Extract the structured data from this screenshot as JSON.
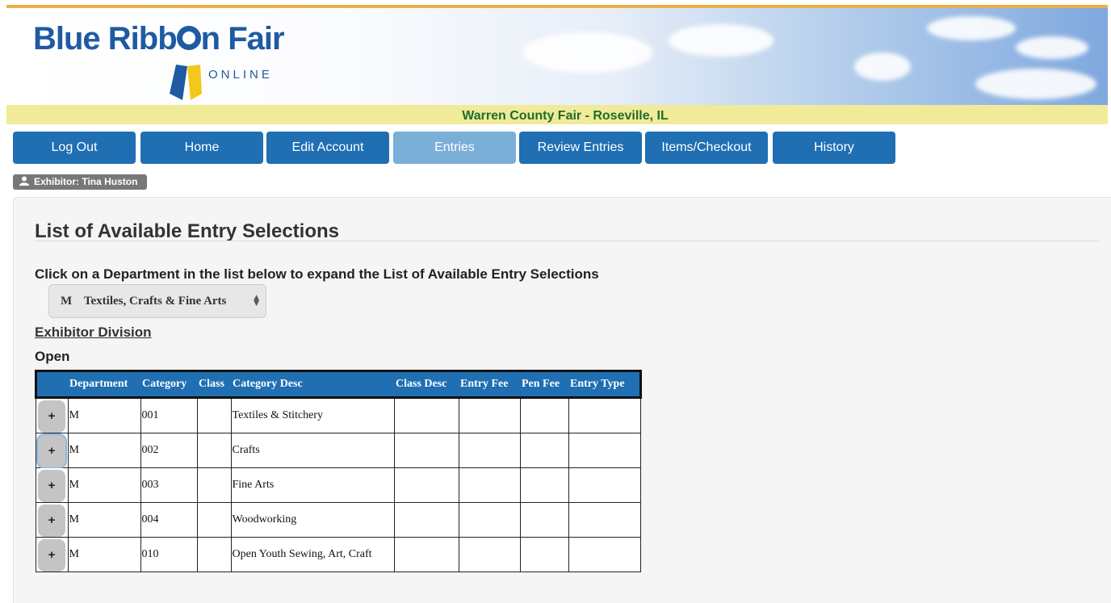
{
  "brand": {
    "logo_text_1": "Blue Ribb",
    "logo_text_2": "n Fair",
    "logo_sub": "ONLINE"
  },
  "fair_name": "Warren County Fair - Roseville, IL",
  "nav": [
    {
      "label": "Log Out",
      "active": false
    },
    {
      "label": "Home",
      "active": false
    },
    {
      "label": "Edit Account",
      "active": false
    },
    {
      "label": "Entries",
      "active": true
    },
    {
      "label": "Review Entries",
      "active": false
    },
    {
      "label": "Items/Checkout",
      "active": false
    },
    {
      "label": "History",
      "active": false
    }
  ],
  "exhibitor_label": "Exhibitor: Tina Huston",
  "page_title": "List of Available Entry Selections",
  "instruction": "Click on a Department in the list below to expand the List of Available Entry Selections",
  "department_select": {
    "selected": "M    Textiles, Crafts & Fine Arts"
  },
  "division_heading": "Exhibitor Division",
  "division_value": "Open",
  "table": {
    "headers": [
      "",
      "Department",
      "Category",
      "Class",
      "Category Desc",
      "Class Desc",
      "Entry Fee",
      "Pen Fee",
      "Entry Type"
    ],
    "expand_label": "+",
    "rows": [
      {
        "department": "M",
        "category": "001",
        "class": "",
        "category_desc": "Textiles & Stitchery",
        "class_desc": "",
        "entry_fee": "",
        "pen_fee": "",
        "entry_type": ""
      },
      {
        "department": "M",
        "category": "002",
        "class": "",
        "category_desc": "Crafts",
        "class_desc": "",
        "entry_fee": "",
        "pen_fee": "",
        "entry_type": ""
      },
      {
        "department": "M",
        "category": "003",
        "class": "",
        "category_desc": "Fine Arts",
        "class_desc": "",
        "entry_fee": "",
        "pen_fee": "",
        "entry_type": ""
      },
      {
        "department": "M",
        "category": "004",
        "class": "",
        "category_desc": "Woodworking",
        "class_desc": "",
        "entry_fee": "",
        "pen_fee": "",
        "entry_type": ""
      },
      {
        "department": "M",
        "category": "010",
        "class": "",
        "category_desc": "Open Youth Sewing, Art, Craft",
        "class_desc": "",
        "entry_fee": "",
        "pen_fee": "",
        "entry_type": ""
      }
    ]
  },
  "colors": {
    "nav_blue": "#1f6fb2",
    "nav_active": "#7aafd8",
    "fair_bar": "#f1ea98",
    "fair_text": "#1f6b2e",
    "logo_blue": "#1f5aa3"
  }
}
